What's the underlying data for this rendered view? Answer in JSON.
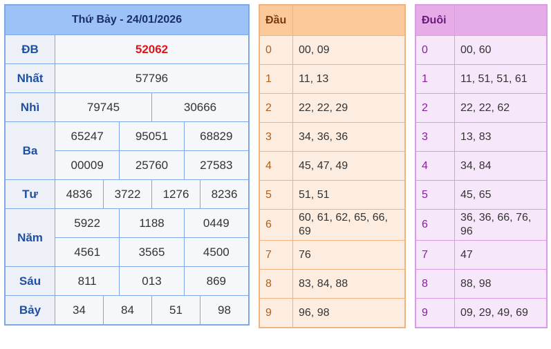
{
  "results": {
    "title": "Thứ Bảy - 24/01/2026",
    "prizes": [
      {
        "label": "ĐB",
        "lines": [
          [
            "52062"
          ]
        ],
        "special": true
      },
      {
        "label": "Nhất",
        "lines": [
          [
            "57796"
          ]
        ]
      },
      {
        "label": "Nhì",
        "lines": [
          [
            "79745",
            "30666"
          ]
        ]
      },
      {
        "label": "Ba",
        "lines": [
          [
            "65247",
            "95051",
            "68829"
          ],
          [
            "00009",
            "25760",
            "27583"
          ]
        ]
      },
      {
        "label": "Tư",
        "lines": [
          [
            "4836",
            "3722",
            "1276",
            "8236"
          ]
        ]
      },
      {
        "label": "Năm",
        "lines": [
          [
            "5922",
            "1188",
            "0449"
          ],
          [
            "4561",
            "3565",
            "4500"
          ]
        ]
      },
      {
        "label": "Sáu",
        "lines": [
          [
            "811",
            "013",
            "869"
          ]
        ]
      },
      {
        "label": "Bảy",
        "lines": [
          [
            "34",
            "84",
            "51",
            "98"
          ]
        ]
      }
    ]
  },
  "dau": {
    "header": "Đầu",
    "rows": [
      {
        "k": "0",
        "v": "00, 09"
      },
      {
        "k": "1",
        "v": "11, 13"
      },
      {
        "k": "2",
        "v": "22, 22, 29"
      },
      {
        "k": "3",
        "v": "34, 36, 36"
      },
      {
        "k": "4",
        "v": "45, 47, 49"
      },
      {
        "k": "5",
        "v": "51, 51"
      },
      {
        "k": "6",
        "v": "60, 61, 62, 65, 66, 69"
      },
      {
        "k": "7",
        "v": "76"
      },
      {
        "k": "8",
        "v": "83, 84, 88"
      },
      {
        "k": "9",
        "v": "96, 98"
      }
    ]
  },
  "duoi": {
    "header": "Đuôi",
    "rows": [
      {
        "k": "0",
        "v": "00, 60"
      },
      {
        "k": "1",
        "v": "11, 51, 51, 61"
      },
      {
        "k": "2",
        "v": "22, 22, 62"
      },
      {
        "k": "3",
        "v": "13, 83"
      },
      {
        "k": "4",
        "v": "34, 84"
      },
      {
        "k": "5",
        "v": "45, 65"
      },
      {
        "k": "6",
        "v": "36, 36, 66, 76, 96"
      },
      {
        "k": "7",
        "v": "47"
      },
      {
        "k": "8",
        "v": "88, 98"
      },
      {
        "k": "9",
        "v": "09, 29, 49, 69"
      }
    ]
  }
}
